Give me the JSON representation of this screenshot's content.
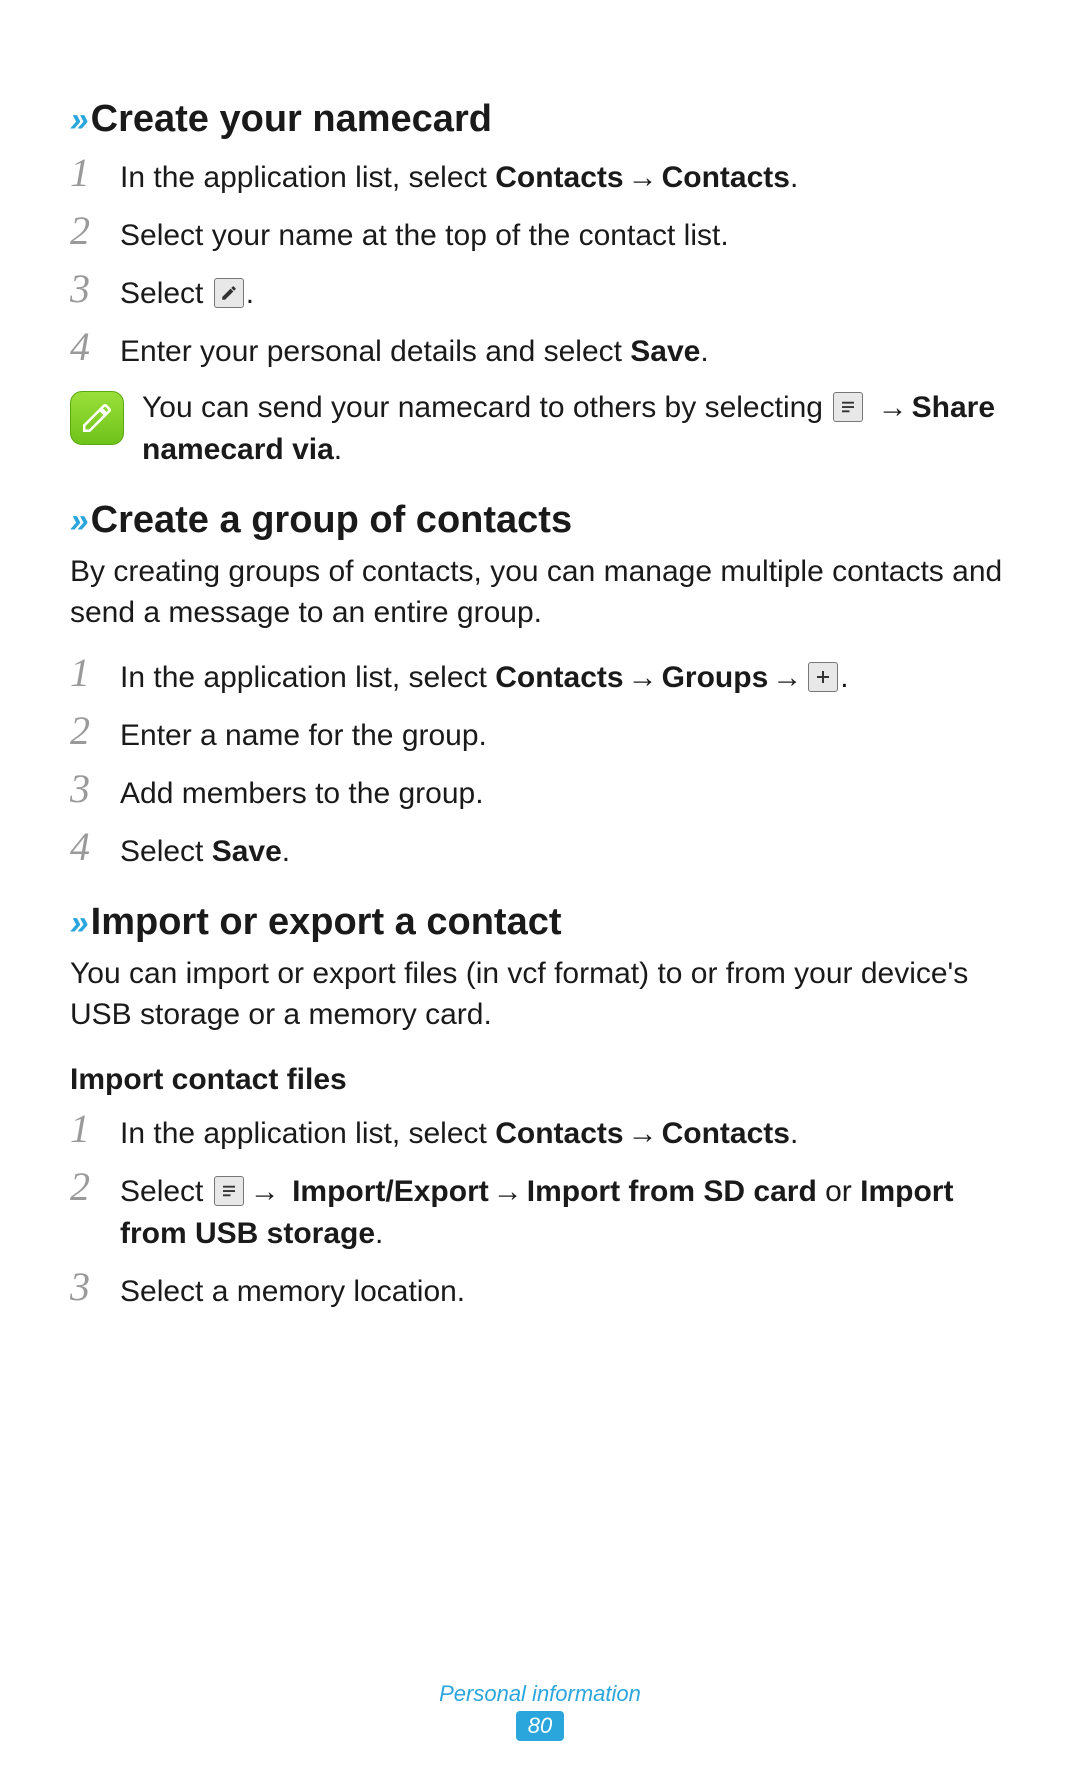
{
  "sections": {
    "s1": {
      "title": "Create your namecard",
      "steps": {
        "st1": {
          "pre": "In the application list, select ",
          "b1": "Contacts",
          "b2": "Contacts",
          "post": "."
        },
        "st2": "Select your name at the top of the contact list.",
        "st3": {
          "pre": "Select ",
          "post": "."
        },
        "st4": {
          "pre": "Enter your personal details and select ",
          "b1": "Save",
          "post": "."
        }
      },
      "note": {
        "pre": "You can send your namecard to others by selecting ",
        "b1": "Share namecard via",
        "post": "."
      }
    },
    "s2": {
      "title": "Create a group of contacts",
      "desc": "By creating groups of contacts, you can manage multiple contacts and send a message to an entire group.",
      "steps": {
        "st1": {
          "pre": "In the application list, select ",
          "b1": "Contacts",
          "b2": "Groups",
          "post": "."
        },
        "st2": "Enter a name for the group.",
        "st3": "Add members to the group.",
        "st4": {
          "pre": "Select ",
          "b1": "Save",
          "post": "."
        }
      }
    },
    "s3": {
      "title": "Import or export a contact",
      "desc": "You can import or export files (in vcf format) to or from your device's USB storage or a memory card.",
      "sub1": {
        "title": "Import contact files",
        "steps": {
          "st1": {
            "pre": "In the application list, select ",
            "b1": "Contacts",
            "b2": "Contacts",
            "post": "."
          },
          "st2": {
            "pre": "Select ",
            "b1": "Import/Export",
            "b2": "Import from SD card",
            "mid": " or ",
            "b3": "Import from USB storage",
            "post": "."
          },
          "st3": "Select a memory location."
        }
      }
    }
  },
  "glyphs": {
    "arrow": "→",
    "arrow_pre": "→ "
  },
  "nums": {
    "n1": "1",
    "n2": "2",
    "n3": "3",
    "n4": "4"
  },
  "footer": {
    "label": "Personal information",
    "page": "80"
  }
}
